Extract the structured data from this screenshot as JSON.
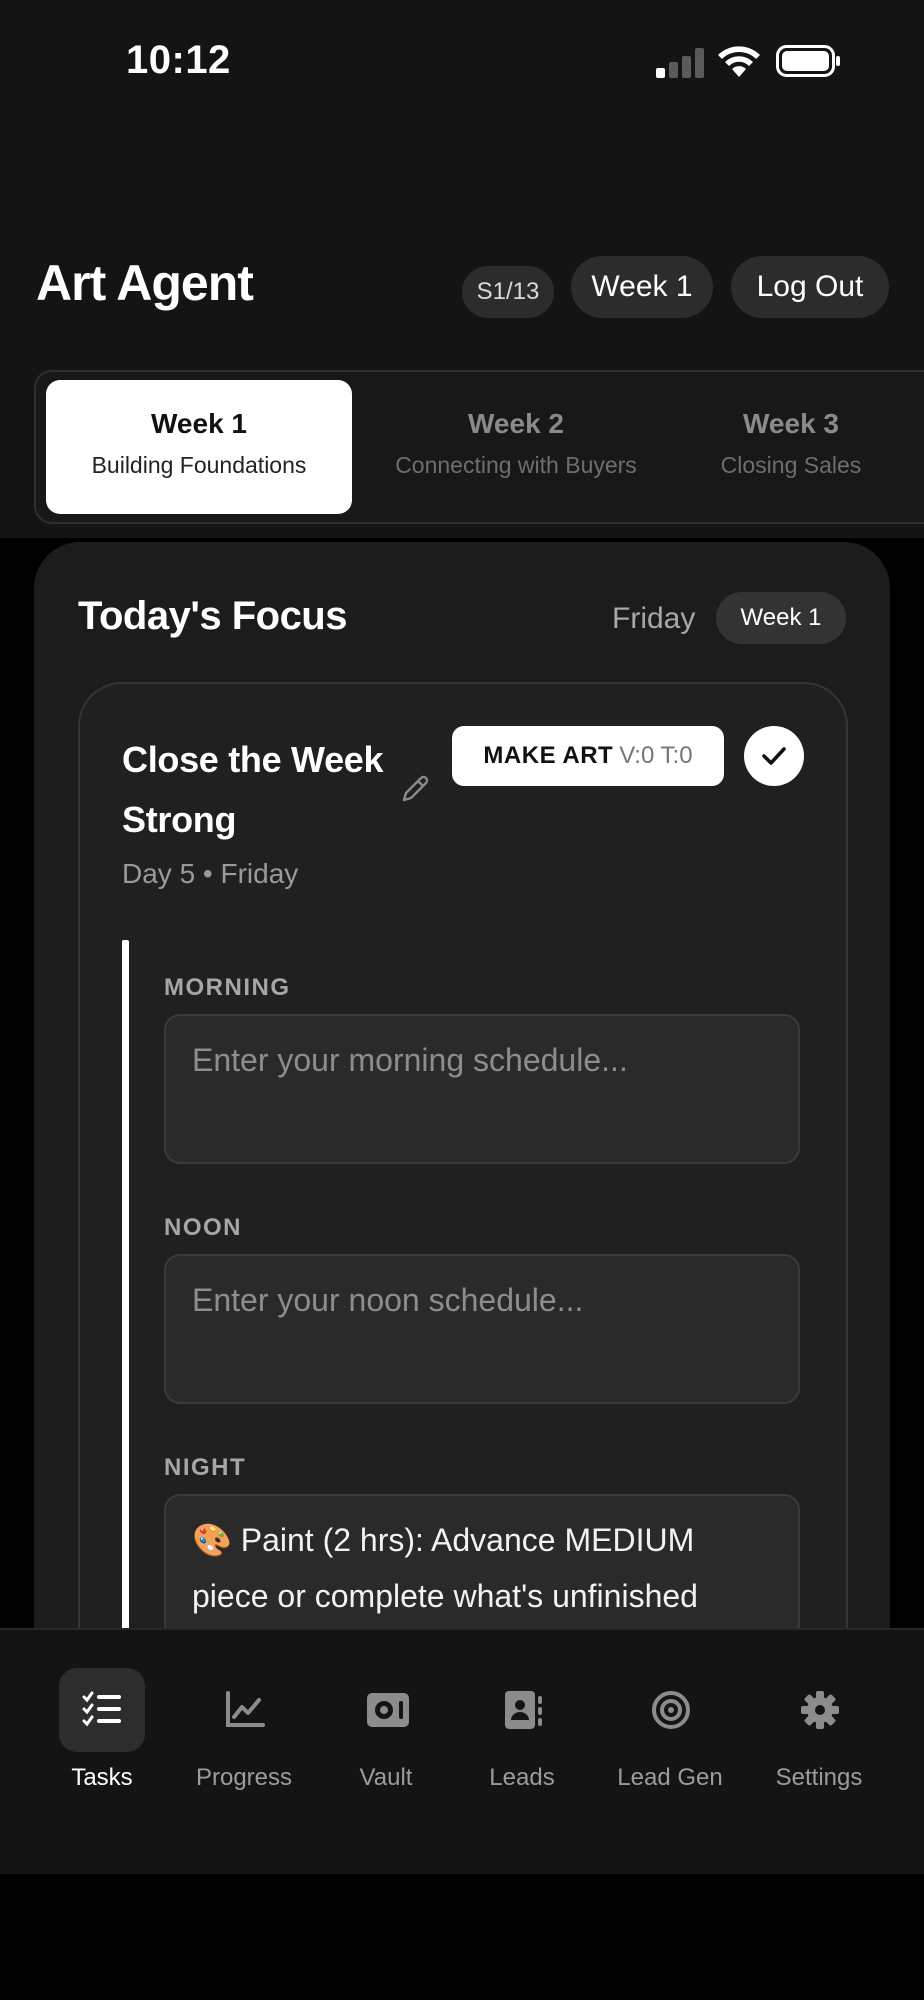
{
  "status_bar": {
    "time": "10:12"
  },
  "header": {
    "title": "Art Agent",
    "session_badge": "S1/13",
    "week_button": "Week 1",
    "logout_button": "Log Out"
  },
  "week_tabs": [
    {
      "title": "Week 1",
      "subtitle": "Building Foundations",
      "active": true
    },
    {
      "title": "Week 2",
      "subtitle": "Connecting with Buyers",
      "active": false
    },
    {
      "title": "Week 3",
      "subtitle": "Closing Sales",
      "active": false
    }
  ],
  "focus": {
    "title": "Today's Focus",
    "day": "Friday",
    "week_badge": "Week 1"
  },
  "task": {
    "title": "Close the Week Strong",
    "make_art_label": "MAKE ART",
    "make_art_counts": "V:0 T:0",
    "subtitle": "Day 5 • Friday",
    "slots": [
      {
        "label": "MORNING",
        "placeholder": "Enter your morning schedule...",
        "value": ""
      },
      {
        "label": "NOON",
        "placeholder": "Enter your noon schedule...",
        "value": ""
      },
      {
        "label": "NIGHT",
        "placeholder": "",
        "value": "🎨 Paint (2 hrs): Advance MEDIUM piece or complete what's unfinished"
      }
    ]
  },
  "bottom_nav": [
    {
      "label": "Tasks",
      "icon": "tasks-icon",
      "active": true
    },
    {
      "label": "Progress",
      "icon": "chart-icon",
      "active": false
    },
    {
      "label": "Vault",
      "icon": "vault-icon",
      "active": false
    },
    {
      "label": "Leads",
      "icon": "contacts-icon",
      "active": false
    },
    {
      "label": "Lead Gen",
      "icon": "target-icon",
      "active": false
    },
    {
      "label": "Settings",
      "icon": "gear-icon",
      "active": false
    }
  ],
  "colors": {
    "background": "#000000",
    "surface": "#141414",
    "card": "#1c1c1c",
    "accent": "#ffffff"
  }
}
